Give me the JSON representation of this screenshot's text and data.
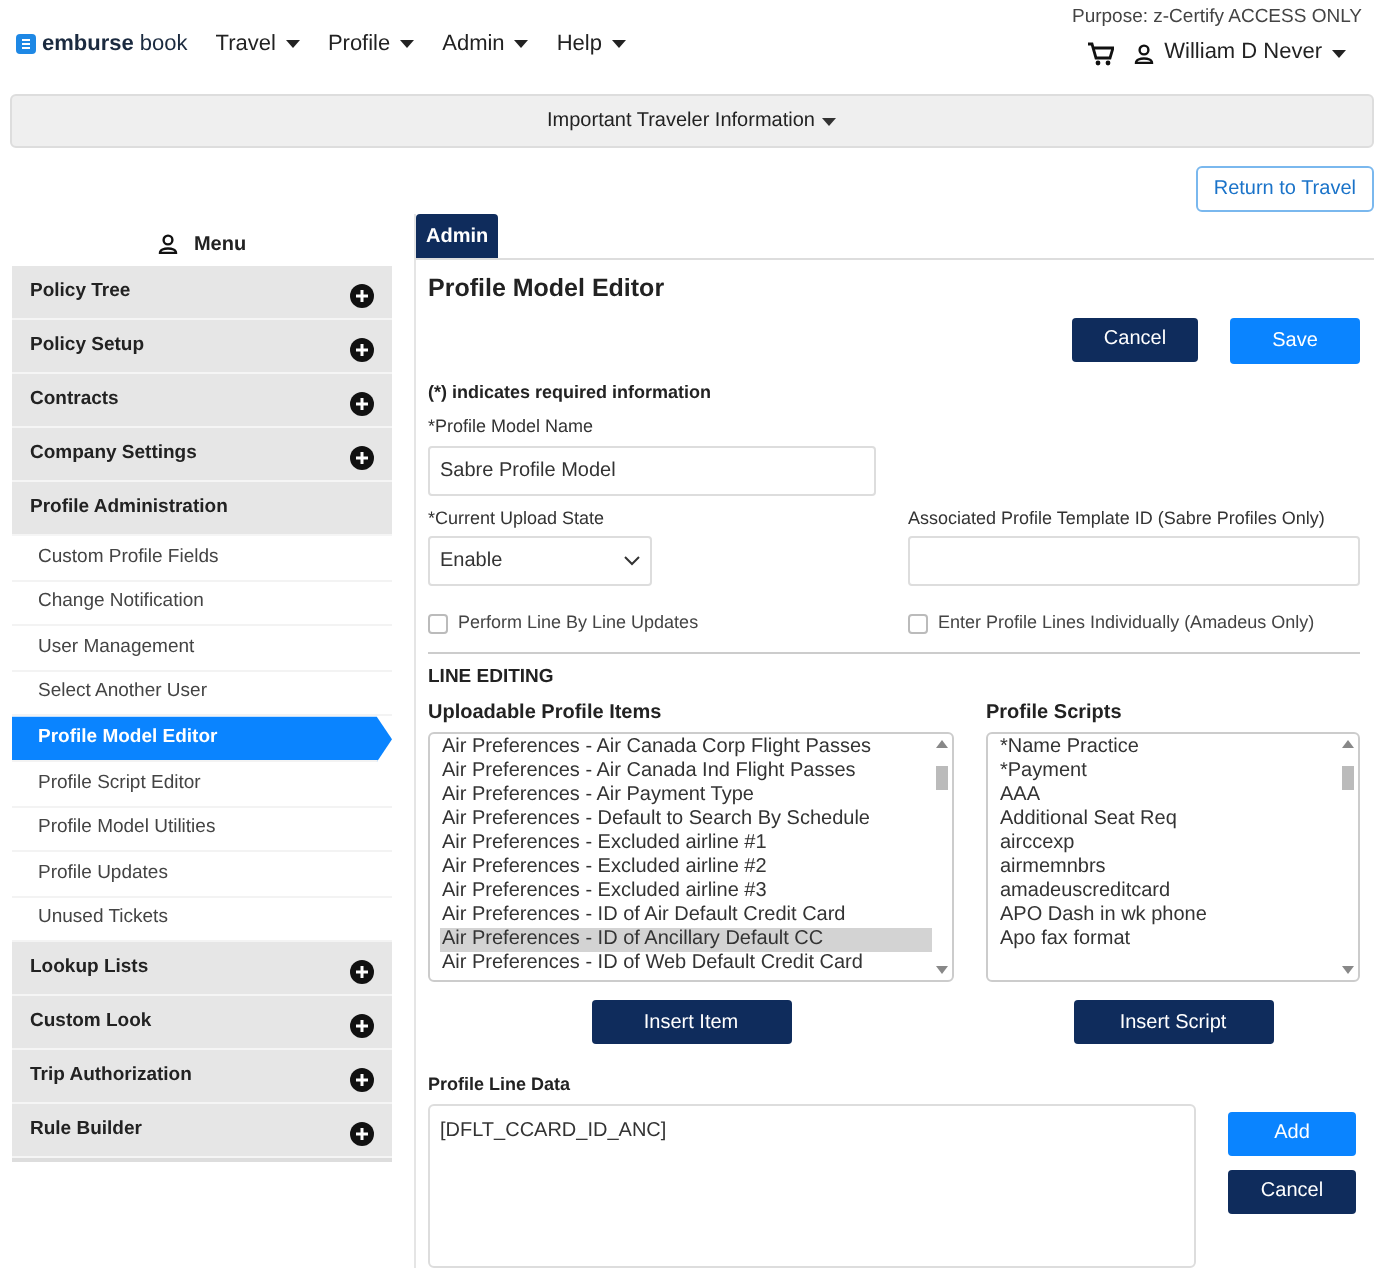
{
  "header": {
    "logo": {
      "brand": "emburse",
      "product": "book"
    },
    "nav": [
      "Travel",
      "Profile",
      "Admin",
      "Help"
    ],
    "purpose": "Purpose: z-Certify ACCESS ONLY",
    "user": "William D Never"
  },
  "banner": {
    "label": "Important Traveler Information"
  },
  "return_button": "Return to Travel",
  "sidebar": {
    "title": "Menu",
    "groups": [
      {
        "label": "Policy Tree",
        "expanded": false
      },
      {
        "label": "Policy Setup",
        "expanded": false
      },
      {
        "label": "Contracts",
        "expanded": false
      },
      {
        "label": "Company Settings",
        "expanded": false
      },
      {
        "label": "Profile Administration",
        "expanded": true,
        "children": [
          {
            "label": "Custom Profile Fields",
            "selected": false
          },
          {
            "label": "Change Notification",
            "selected": false
          },
          {
            "label": "User Management",
            "selected": false
          },
          {
            "label": "Select Another User",
            "selected": false
          },
          {
            "label": "Profile Model Editor",
            "selected": true
          },
          {
            "label": "Profile Script Editor",
            "selected": false
          },
          {
            "label": "Profile Model Utilities",
            "selected": false
          },
          {
            "label": "Profile Updates",
            "selected": false
          },
          {
            "label": "Unused Tickets",
            "selected": false
          }
        ]
      },
      {
        "label": "Lookup Lists",
        "expanded": false
      },
      {
        "label": "Custom Look",
        "expanded": false
      },
      {
        "label": "Trip Authorization",
        "expanded": false
      },
      {
        "label": "Rule Builder",
        "expanded": false
      }
    ]
  },
  "tabs": [
    {
      "label": "Admin",
      "selected": true
    }
  ],
  "editor": {
    "title": "Profile Model Editor",
    "buttons": {
      "cancel": "Cancel",
      "save": "Save"
    },
    "required_note": "(*) indicates required information",
    "model_name": {
      "label": "*Profile Model Name",
      "value": "Sabre Profile Model"
    },
    "upload_state": {
      "label": "*Current Upload State",
      "value": "Enable"
    },
    "template_id": {
      "label": "Associated Profile Template ID (Sabre Profiles Only)"
    },
    "checkboxes": [
      {
        "label": "Perform Line By Line Updates",
        "checked": false
      },
      {
        "label": "Enter Profile Lines Individually (Amadeus Only)",
        "checked": false
      }
    ],
    "section": "LINE EDITING",
    "items": {
      "label": "Uploadable Profile Items",
      "button": "Insert Item",
      "options": [
        {
          "label": "Air Preferences - Air Canada Corp Flight Passes",
          "selected": false
        },
        {
          "label": "Air Preferences - Air Canada Ind Flight Passes",
          "selected": false
        },
        {
          "label": "Air Preferences - Air Payment Type",
          "selected": false
        },
        {
          "label": "Air Preferences - Default to Search By Schedule",
          "selected": false
        },
        {
          "label": "Air Preferences - Excluded airline #1",
          "selected": false
        },
        {
          "label": "Air Preferences - Excluded airline #2",
          "selected": false
        },
        {
          "label": "Air Preferences - Excluded airline #3",
          "selected": false
        },
        {
          "label": "Air Preferences - ID of Air Default Credit Card",
          "selected": false
        },
        {
          "label": "Air Preferences - ID of Ancillary Default CC",
          "selected": true
        },
        {
          "label": "Air Preferences - ID of Web Default Credit Card",
          "selected": false
        }
      ]
    },
    "scripts": {
      "label": "Profile Scripts",
      "button": "Insert Script",
      "options": [
        {
          "label": "*Name Practice",
          "selected": false
        },
        {
          "label": "*Payment",
          "selected": false
        },
        {
          "label": "AAA",
          "selected": false
        },
        {
          "label": "Additional Seat Req",
          "selected": false
        },
        {
          "label": "airccexp",
          "selected": false
        },
        {
          "label": "airmemnbrs",
          "selected": false
        },
        {
          "label": "amadeuscreditcard",
          "selected": false
        },
        {
          "label": "APO Dash in wk phone",
          "selected": false
        },
        {
          "label": "Apo fax format",
          "selected": false
        }
      ]
    },
    "line_data": {
      "label": "Profile Line Data",
      "value": "[DFLT_CCARD_ID_ANC]",
      "add": "Add",
      "cancel": "Cancel"
    }
  }
}
